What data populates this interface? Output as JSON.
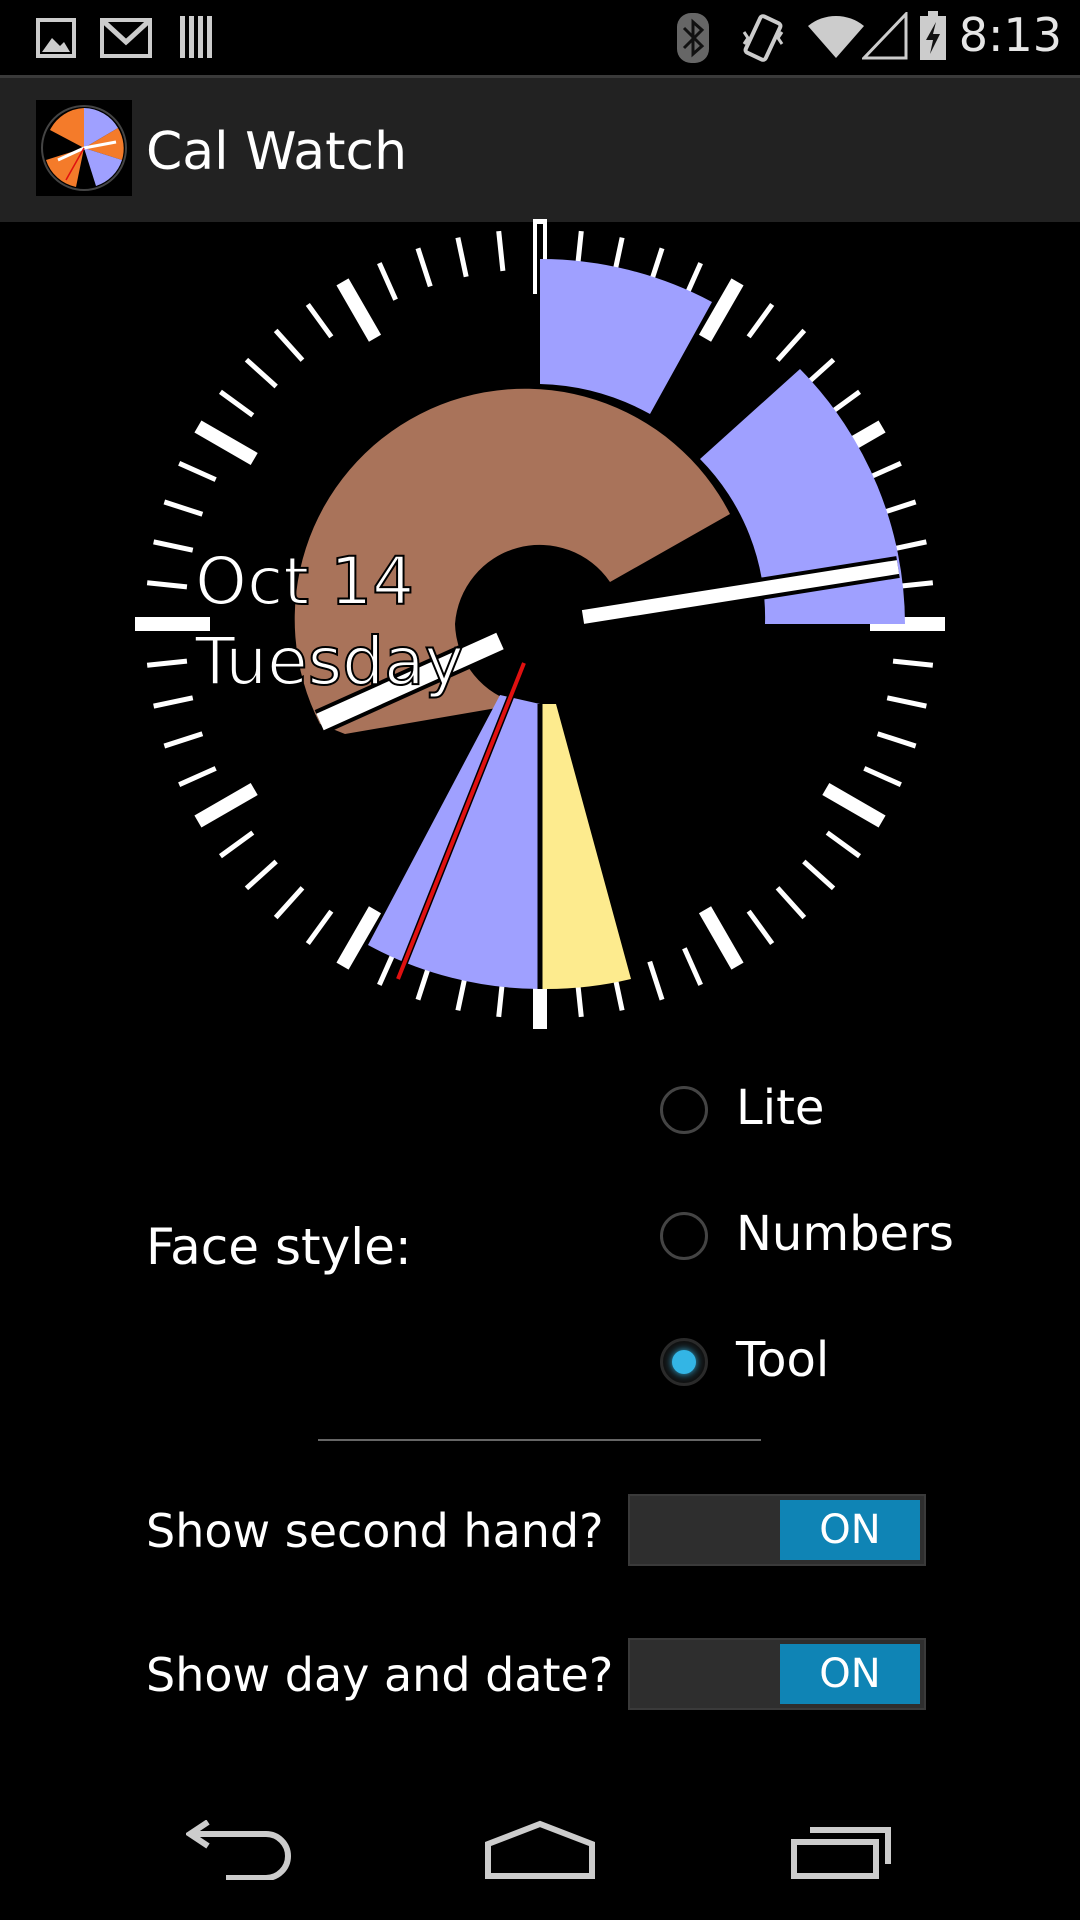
{
  "status_bar": {
    "time": "8:13",
    "left_icons": [
      "picture-icon",
      "gmail-icon",
      "barcode-icon"
    ],
    "right_icons": [
      "bluetooth-icon",
      "vibrate-icon",
      "wifi-icon",
      "signal-icon",
      "battery-charging-icon"
    ]
  },
  "action_bar": {
    "title": "Cal Watch",
    "app_icon": "cal-watch-icon"
  },
  "watch_face": {
    "date_line": "Oct 14",
    "day_line": "Tuesday",
    "colors": {
      "event_blue": "#9fa0ff",
      "event_brown": "#a9735a",
      "event_yellow": "#fdeb8e",
      "second_hand": "#e01010",
      "hands": "#ffffff"
    }
  },
  "face_style": {
    "label": "Face style:",
    "options": [
      {
        "label": "Lite",
        "checked": false
      },
      {
        "label": "Numbers",
        "checked": false
      },
      {
        "label": "Tool",
        "checked": true
      }
    ]
  },
  "settings": {
    "second_hand": {
      "label": "Show second hand?",
      "state": "ON"
    },
    "day_date": {
      "label": "Show day and date?",
      "state": "ON"
    }
  },
  "nav_bar": {
    "buttons": [
      "back-icon",
      "home-icon",
      "recents-icon"
    ]
  }
}
